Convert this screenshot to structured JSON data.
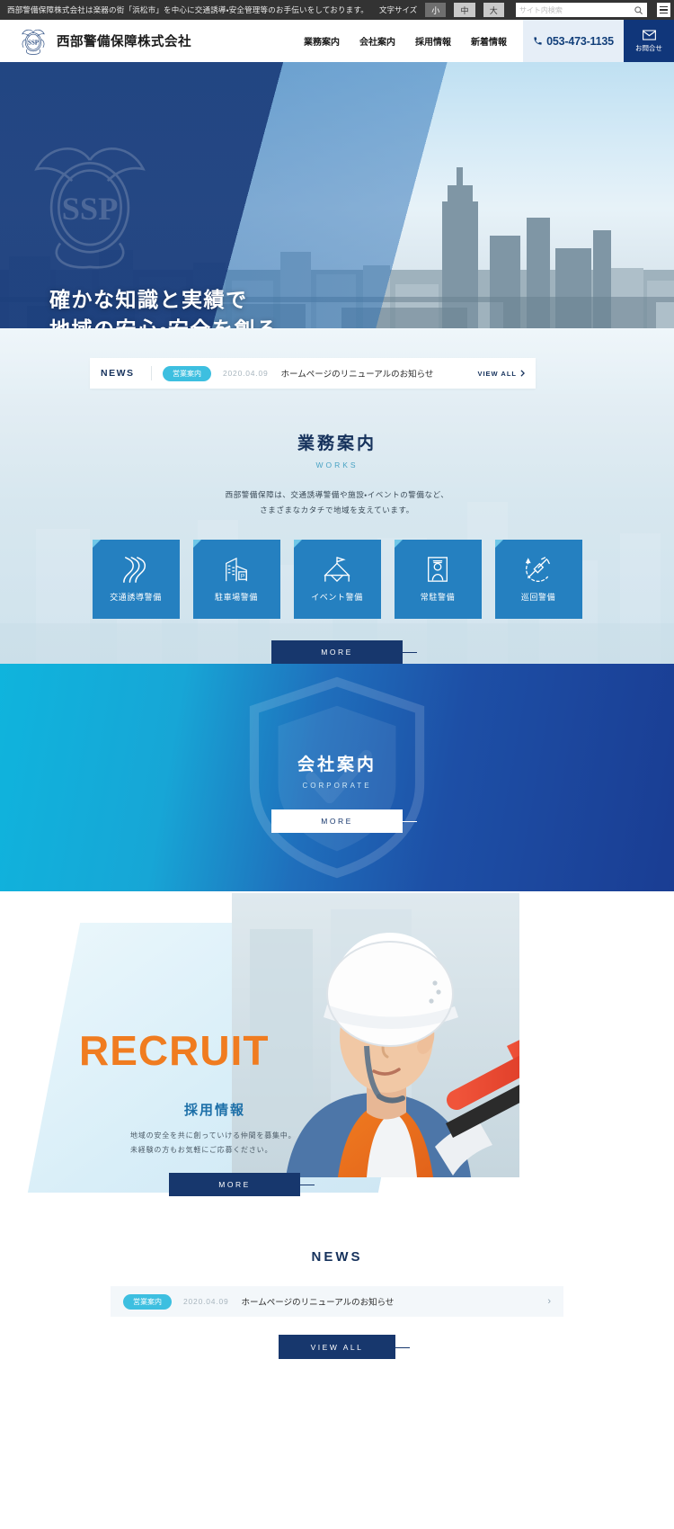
{
  "utilbar": {
    "tagline": "西部警備保障株式会社は楽器の街「浜松市」を中心に交通誘導・安全管理等のお手伝いをしております。",
    "fontsize_label": "文字サイズ",
    "size_small": "小",
    "size_medium": "中",
    "size_large": "大",
    "search_placeholder": "サイト内検索"
  },
  "header": {
    "logo_text": "SSP",
    "company_name": "西部警備保障株式会社",
    "nav": [
      {
        "label": "業務案内"
      },
      {
        "label": "会社案内"
      },
      {
        "label": "採用情報"
      },
      {
        "label": "新着情報"
      }
    ],
    "phone": "053-473-1135",
    "contact_label": "お問合せ"
  },
  "hero": {
    "line1": "確かな知識と実績で",
    "line2": "地域の安心・安全を創る",
    "watermark": "SSP"
  },
  "news_strip": {
    "label": "NEWS",
    "badge": "営業案内",
    "date": "2020.04.09",
    "title": "ホームページのリニューアルのお知らせ",
    "view_all": "VIEW ALL"
  },
  "works": {
    "title": "業務案内",
    "subtitle": "WORKS",
    "desc_line1": "西部警備保障は、交通誘導警備や施設・イベントの警備など、",
    "desc_line2": "さまざまなカタチで地域を支えています。",
    "cards": [
      {
        "label": "交通誘導警備",
        "icon": "road-icon"
      },
      {
        "label": "駐車場警備",
        "icon": "parking-building-icon"
      },
      {
        "label": "イベント警備",
        "icon": "tent-flag-icon"
      },
      {
        "label": "常駐警備",
        "icon": "guard-person-icon"
      },
      {
        "label": "巡回警備",
        "icon": "patrol-flashlight-icon"
      }
    ],
    "more_label": "MORE"
  },
  "corporate": {
    "title": "会社案内",
    "subtitle": "CORPORATE",
    "more_label": "MORE"
  },
  "recruit": {
    "title_en": "RECRUIT",
    "title_ja": "採用情報",
    "desc_line1": "地域の安全を共に創っていける仲間を募集中。",
    "desc_line2": "未経験の方もお気軽にご応募ください。",
    "more_label": "MORE"
  },
  "news_section": {
    "title": "NEWS",
    "items": [
      {
        "badge": "営業案内",
        "date": "2020.04.09",
        "title": "ホームページのリニューアルのお知らせ"
      }
    ],
    "view_all": "VIEW ALL"
  },
  "colors": {
    "brand_navy": "#17376d",
    "brand_blue": "#2580c0",
    "accent_cyan": "#3dbfe0",
    "accent_orange": "#f07c20"
  }
}
